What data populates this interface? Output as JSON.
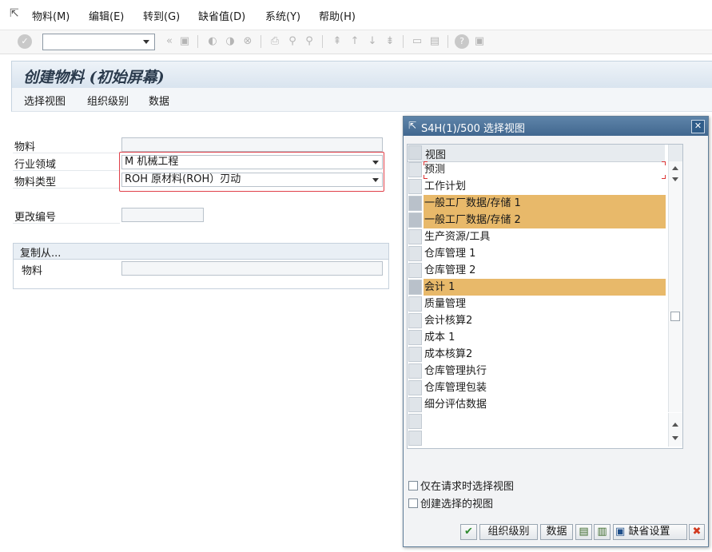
{
  "menu": {
    "items": [
      "物料(M)",
      "编辑(E)",
      "转到(G)",
      "缺省值(D)",
      "系统(Y)",
      "帮助(H)"
    ]
  },
  "toolbar": {
    "command_field_value": ""
  },
  "page": {
    "title": "创建物料 (初始屏幕)"
  },
  "app_toolbar": {
    "buttons": [
      "选择视图",
      "组织级别",
      "数据"
    ]
  },
  "form": {
    "material_label": "物料",
    "material_value": "",
    "industry_label": "行业领域",
    "industry_value": "M 机械工程",
    "type_label": "物料类型",
    "type_value": "ROH 原材料(ROH）刃动",
    "change_no_label": "更改编号",
    "change_no_value": "",
    "copy_from_title": "复制从...",
    "copy_material_label": "物料",
    "copy_material_value": ""
  },
  "dialog": {
    "title": "S4H(1)/500 选择视图",
    "column_header": "视图",
    "rows": [
      {
        "label": "预测",
        "selected": false
      },
      {
        "label": "工作计划",
        "selected": false
      },
      {
        "label": "一般工厂数据/存储 1",
        "selected": true
      },
      {
        "label": "一般工厂数据/存储 2",
        "selected": true
      },
      {
        "label": "生产资源/工具",
        "selected": false
      },
      {
        "label": "仓库管理 1",
        "selected": false
      },
      {
        "label": "仓库管理 2",
        "selected": false
      },
      {
        "label": "会计 1",
        "selected": true
      },
      {
        "label": "质量管理",
        "selected": false
      },
      {
        "label": "会计核算2",
        "selected": false
      },
      {
        "label": "成本 1",
        "selected": false
      },
      {
        "label": "成本核算2",
        "selected": false
      },
      {
        "label": "仓库管理执行",
        "selected": false
      },
      {
        "label": "仓库管理包装",
        "selected": false
      },
      {
        "label": "细分评估数据",
        "selected": false
      }
    ],
    "checkbox_only_on_request": "仅在请求时选择视图",
    "checkbox_create_selected": "创建选择的视图",
    "btn_org_level": "组织级别",
    "btn_data": "数据",
    "btn_default_settings": "缺省设置",
    "selection_color": "#e8b96a"
  }
}
